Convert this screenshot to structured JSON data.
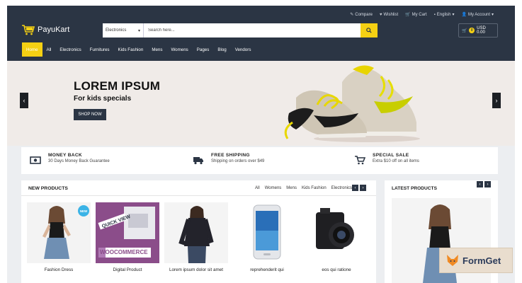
{
  "topbar": {
    "links": [
      {
        "icon": "compare-icon",
        "label": "Compare"
      },
      {
        "icon": "heart-icon",
        "label": "Wishlist"
      },
      {
        "icon": "cart-icon",
        "label": "My Cart"
      },
      {
        "icon": "flag-icon",
        "label": "English"
      },
      {
        "icon": "user-icon",
        "label": "My Account"
      }
    ]
  },
  "logo": {
    "text": "PayuKart"
  },
  "search": {
    "category": "Electronics",
    "placeholder": "Search here..."
  },
  "cart": {
    "count": "0",
    "total": "USD 0.00"
  },
  "nav": [
    "Home",
    "All",
    "Electronics",
    "Furnitures",
    "Kids Fashion",
    "Mens",
    "Womens",
    "Pages",
    "Blog",
    "Vendors"
  ],
  "hero": {
    "title": "LOREM IPSUM",
    "subtitle": "For kids specials",
    "button": "SHOP NOW"
  },
  "features": [
    {
      "icon": "money-icon",
      "title": "MONEY BACK",
      "desc": "30 Days Money Back Guarantee"
    },
    {
      "icon": "truck-icon",
      "title": "FREE SHIPPING",
      "desc": "Shipping on orders over $49"
    },
    {
      "icon": "cart-icon",
      "title": "SPECIAL SALE",
      "desc": "Extra $10 off on all items"
    }
  ],
  "new_products": {
    "title": "NEW PRODUCTS",
    "tabs": [
      "All",
      "Womens",
      "Mens",
      "Kids Fashion",
      "Electronics"
    ],
    "badge": "NEW",
    "items": [
      {
        "name": "Fashion Dress"
      },
      {
        "name": "Digital Product",
        "image_text_1": "QUICK VIEW",
        "image_text_2": "WOOCOMMERCE"
      },
      {
        "name": "Lorem ipsum dolor sit amet"
      },
      {
        "name": "reprehenderit qui"
      },
      {
        "name": "eos qui ratione"
      }
    ]
  },
  "latest_products": {
    "title": "LATEST PRODUCTS"
  },
  "watermark": {
    "text": "FormGet"
  },
  "colors": {
    "header": "#2b3544",
    "accent": "#f5d013",
    "badge": "#3bb3e6",
    "woo_purple": "#8a4f8a"
  }
}
